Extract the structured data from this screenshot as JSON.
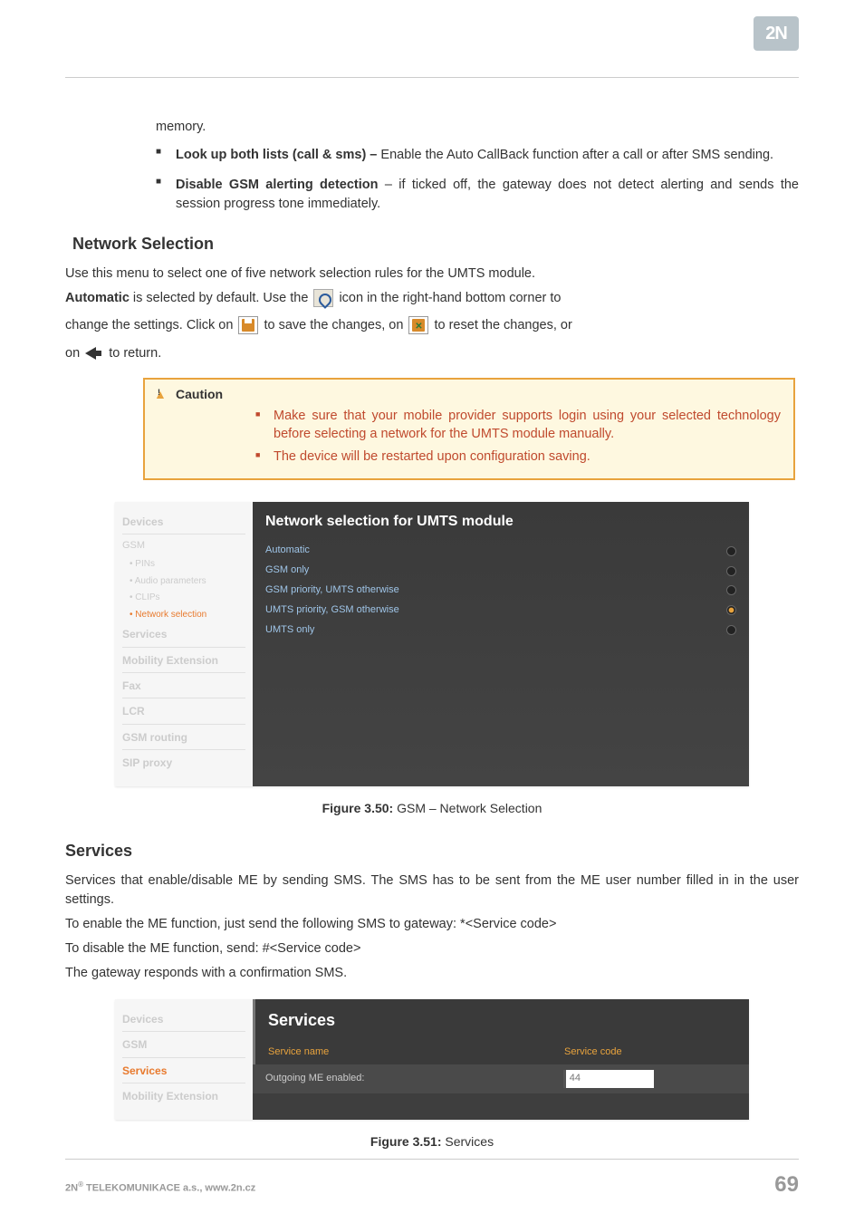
{
  "logo": "2N",
  "memory_line": "memory.",
  "bullets": [
    {
      "bold": "Look up both lists (call & sms) – ",
      "rest": "Enable the Auto CallBack function after a call or after SMS sending."
    },
    {
      "bold": "Disable GSM alerting detection",
      "rest": " – if ticked off, the gateway does not detect alerting and sends the session progress tone immediately."
    }
  ],
  "network_heading": "Network Selection",
  "network_intro": "Use this menu to select one of five network selection rules for the UMTS module.",
  "auto_line_1a": "Automatic",
  "auto_line_1b": " is selected by default. Use the ",
  "auto_line_1c": " icon in the right-hand bottom corner to",
  "auto_line_2a": "change the settings. Click on ",
  "auto_line_2b": " to save the changes, on ",
  "auto_line_2c": " to reset the changes, or",
  "auto_line_3a": "on ",
  "auto_line_3b": " to return.",
  "caution_title": "Caution",
  "caution_items": [
    "Make sure that your mobile provider supports login using your selected technology before selecting a network for the UMTS module manually.",
    "The device will be restarted upon configuration saving."
  ],
  "ss1": {
    "nav_devices": "Devices",
    "nav_gsm": "GSM",
    "nav_pins": "• PINs",
    "nav_audio": "• Audio parameters",
    "nav_clips": "• CLIPs",
    "nav_netsel": "• Network selection",
    "nav_services": "Services",
    "nav_me": "Mobility Extension",
    "nav_fax": "Fax",
    "nav_lcr": "LCR",
    "nav_gsmrouting": "GSM routing",
    "nav_sip": "SIP proxy",
    "main_title": "Network selection for UMTS module",
    "rows": [
      {
        "label": "Automatic",
        "selected": false
      },
      {
        "label": "GSM only",
        "selected": false
      },
      {
        "label": "GSM priority, UMTS otherwise",
        "selected": false
      },
      {
        "label": "UMTS priority, GSM otherwise",
        "selected": true
      },
      {
        "label": "UMTS only",
        "selected": false
      }
    ]
  },
  "fig1_bold": "Figure 3.50:",
  "fig1_rest": " GSM – Network Selection",
  "services_heading": "Services",
  "services_p1": "Services that enable/disable ME by sending SMS. The SMS has to be sent from the ME user number filled in in the user settings.",
  "services_p2": "To enable the ME function, just send the following SMS to gateway: *<Service code>",
  "services_p3": "To disable the ME function, send: #<Service code>",
  "services_p4": "The gateway responds with a confirmation SMS.",
  "ss2": {
    "nav_devices": "Devices",
    "nav_gsm": "GSM",
    "nav_services": "Services",
    "nav_me": "Mobility Extension",
    "main_title": "Services",
    "col1": "Service name",
    "col2": "Service code",
    "row_label": "Outgoing ME enabled:",
    "row_value": "44"
  },
  "fig2_bold": "Figure 3.51:",
  "fig2_rest": " Services",
  "footer_company": "2N",
  "footer_rest": " TELEKOMUNIKACE a.s., www.2n.cz",
  "footer_reg": "®",
  "page_number": "69"
}
